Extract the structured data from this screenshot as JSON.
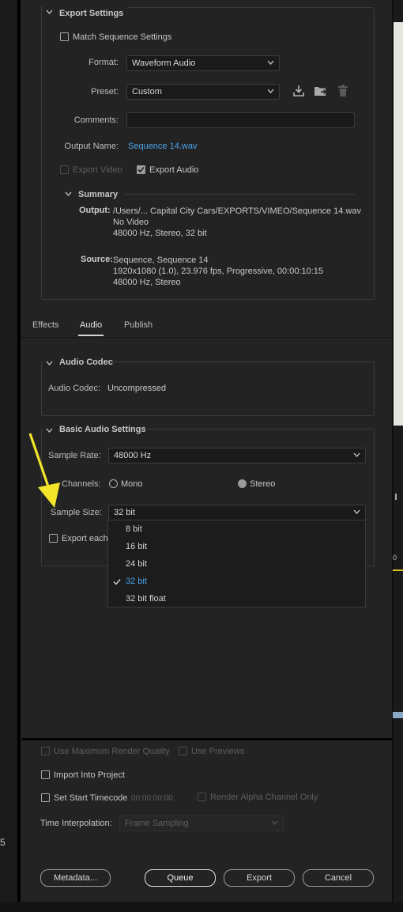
{
  "export_settings": {
    "section_title": "Export Settings",
    "match_sequence_label": "Match Sequence Settings",
    "format_label": "Format:",
    "format_value": "Waveform Audio",
    "preset_label": "Preset:",
    "preset_value": "Custom",
    "comments_label": "Comments:",
    "comments_value": "",
    "output_name_label": "Output Name:",
    "output_name_value": "Sequence 14.wav",
    "export_video_label": "Export Video",
    "export_audio_label": "Export Audio",
    "export_video_checked": false,
    "export_audio_checked": true,
    "summary": {
      "title": "Summary",
      "output_label": "Output:",
      "output_lines": [
        "/Users/... Capital City Cars/EXPORTS/VIMEO/Sequence 14.wav",
        "No Video",
        "48000 Hz, Stereo, 32 bit"
      ],
      "source_label": "Source:",
      "source_lines": [
        "Sequence, Sequence 14",
        "1920x1080 (1.0), 23.976 fps, Progressive, 00:00:10:15",
        "48000 Hz, Stereo"
      ]
    }
  },
  "tabs": [
    {
      "label": "Effects",
      "active": false
    },
    {
      "label": "Audio",
      "active": true
    },
    {
      "label": "Publish",
      "active": false
    }
  ],
  "audio_codec": {
    "section_title": "Audio Codec",
    "label": "Audio Codec:",
    "value": "Uncompressed"
  },
  "basic_audio": {
    "section_title": "Basic Audio Settings",
    "sample_rate_label": "Sample Rate:",
    "sample_rate_value": "48000 Hz",
    "channels_label": "Channels:",
    "mono_label": "Mono",
    "stereo_label": "Stereo",
    "channel_selected": "Stereo",
    "sample_size_label": "Sample Size:",
    "sample_size_value": "32 bit",
    "export_each_label": "Export each",
    "sample_size_options": [
      "8 bit",
      "16 bit",
      "24 bit",
      "32 bit",
      "32 bit float"
    ],
    "sample_size_selected": "32 bit"
  },
  "bottom": {
    "max_render_label": "Use Maximum Render Quality",
    "use_previews_label": "Use Previews",
    "import_label": "Import Into Project",
    "set_start_label": "Set Start Timecode",
    "start_timecode": "00:00:00:00",
    "render_alpha_label": "Render Alpha Channel Only",
    "time_interp_label": "Time Interpolation:",
    "time_interp_value": "Frame Sampling",
    "metadata_button": "Metadata...",
    "queue_button": "Queue",
    "export_button": "Export",
    "cancel_button": "Cancel"
  },
  "left_edge_number": "5",
  "colors": {
    "accent": "#4aa3ea",
    "annotation_arrow": "#f2e52a",
    "panel_bg": "#232323"
  },
  "icons": {
    "caret": "chevron-down-icon",
    "import_preset": "import-preset-icon",
    "save_preset": "save-preset-icon",
    "delete_preset": "trash-icon",
    "check": "checkmark-icon"
  }
}
